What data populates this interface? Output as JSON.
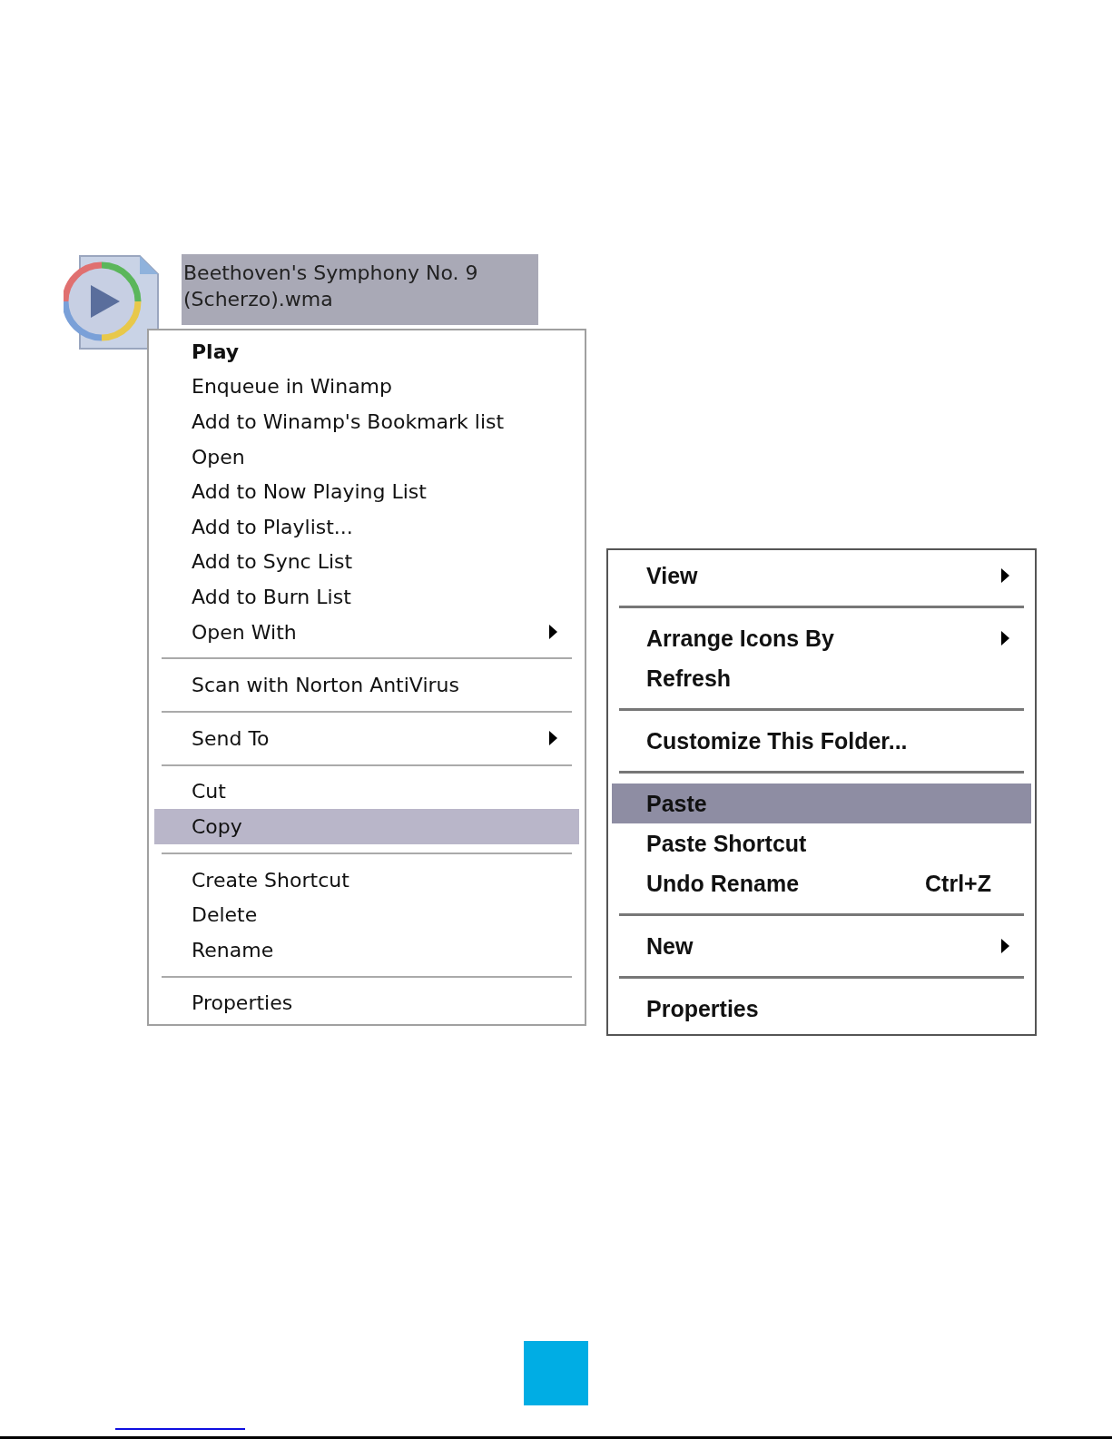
{
  "file": {
    "name_lines": [
      "Beethoven's Symphony No. 9",
      "(Scherzo).wma"
    ],
    "selected": true
  },
  "menus": [
    {
      "items": [
        {
          "kind": "item",
          "label": "Play",
          "default": true,
          "submenu": false,
          "selected": false
        },
        {
          "kind": "item",
          "label": "Enqueue in Winamp",
          "default": false,
          "submenu": false,
          "selected": false
        },
        {
          "kind": "item",
          "label": "Add to Winamp's Bookmark list",
          "default": false,
          "submenu": false,
          "selected": false
        },
        {
          "kind": "item",
          "label": "Open",
          "default": false,
          "submenu": false,
          "selected": false
        },
        {
          "kind": "item",
          "label": "Add to Now Playing List",
          "default": false,
          "submenu": false,
          "selected": false
        },
        {
          "kind": "item",
          "label": "Add to Playlist...",
          "default": false,
          "submenu": false,
          "selected": false
        },
        {
          "kind": "item",
          "label": "Add to Sync List",
          "default": false,
          "submenu": false,
          "selected": false
        },
        {
          "kind": "item",
          "label": "Add to Burn List",
          "default": false,
          "submenu": false,
          "selected": false
        },
        {
          "kind": "item",
          "label": "Open With",
          "default": false,
          "submenu": true,
          "selected": false
        },
        {
          "kind": "separator"
        },
        {
          "kind": "item",
          "label": "Scan with Norton AntiVirus",
          "default": false,
          "submenu": false,
          "selected": false
        },
        {
          "kind": "separator"
        },
        {
          "kind": "item",
          "label": "Send To",
          "default": false,
          "submenu": true,
          "selected": false
        },
        {
          "kind": "separator"
        },
        {
          "kind": "item",
          "label": "Cut",
          "default": false,
          "submenu": false,
          "selected": false
        },
        {
          "kind": "item",
          "label": "Copy",
          "default": false,
          "submenu": false,
          "selected": true
        },
        {
          "kind": "separator"
        },
        {
          "kind": "item",
          "label": "Create Shortcut",
          "default": false,
          "submenu": false,
          "selected": false
        },
        {
          "kind": "item",
          "label": "Delete",
          "default": false,
          "submenu": false,
          "selected": false
        },
        {
          "kind": "item",
          "label": "Rename",
          "default": false,
          "submenu": false,
          "selected": false
        },
        {
          "kind": "separator"
        },
        {
          "kind": "item",
          "label": "Properties",
          "default": false,
          "submenu": false,
          "selected": false
        }
      ]
    },
    {
      "items": [
        {
          "kind": "item",
          "label": "View",
          "submenu": true,
          "selected": false
        },
        {
          "kind": "separator"
        },
        {
          "kind": "item",
          "label": "Arrange Icons By",
          "submenu": true,
          "selected": false
        },
        {
          "kind": "item",
          "label": "Refresh",
          "submenu": false,
          "selected": false
        },
        {
          "kind": "separator"
        },
        {
          "kind": "item",
          "label": "Customize This Folder...",
          "submenu": false,
          "selected": false
        },
        {
          "kind": "separator"
        },
        {
          "kind": "item",
          "label": "Paste",
          "submenu": false,
          "selected": true
        },
        {
          "kind": "item",
          "label": "Paste Shortcut",
          "submenu": false,
          "selected": false
        },
        {
          "kind": "item",
          "label": "Undo Rename",
          "shortcut": "Ctrl+Z",
          "submenu": false,
          "selected": false
        },
        {
          "kind": "separator"
        },
        {
          "kind": "item",
          "label": "New",
          "submenu": true,
          "selected": false
        },
        {
          "kind": "separator"
        },
        {
          "kind": "item",
          "label": "Properties",
          "submenu": false,
          "selected": false
        }
      ]
    }
  ]
}
